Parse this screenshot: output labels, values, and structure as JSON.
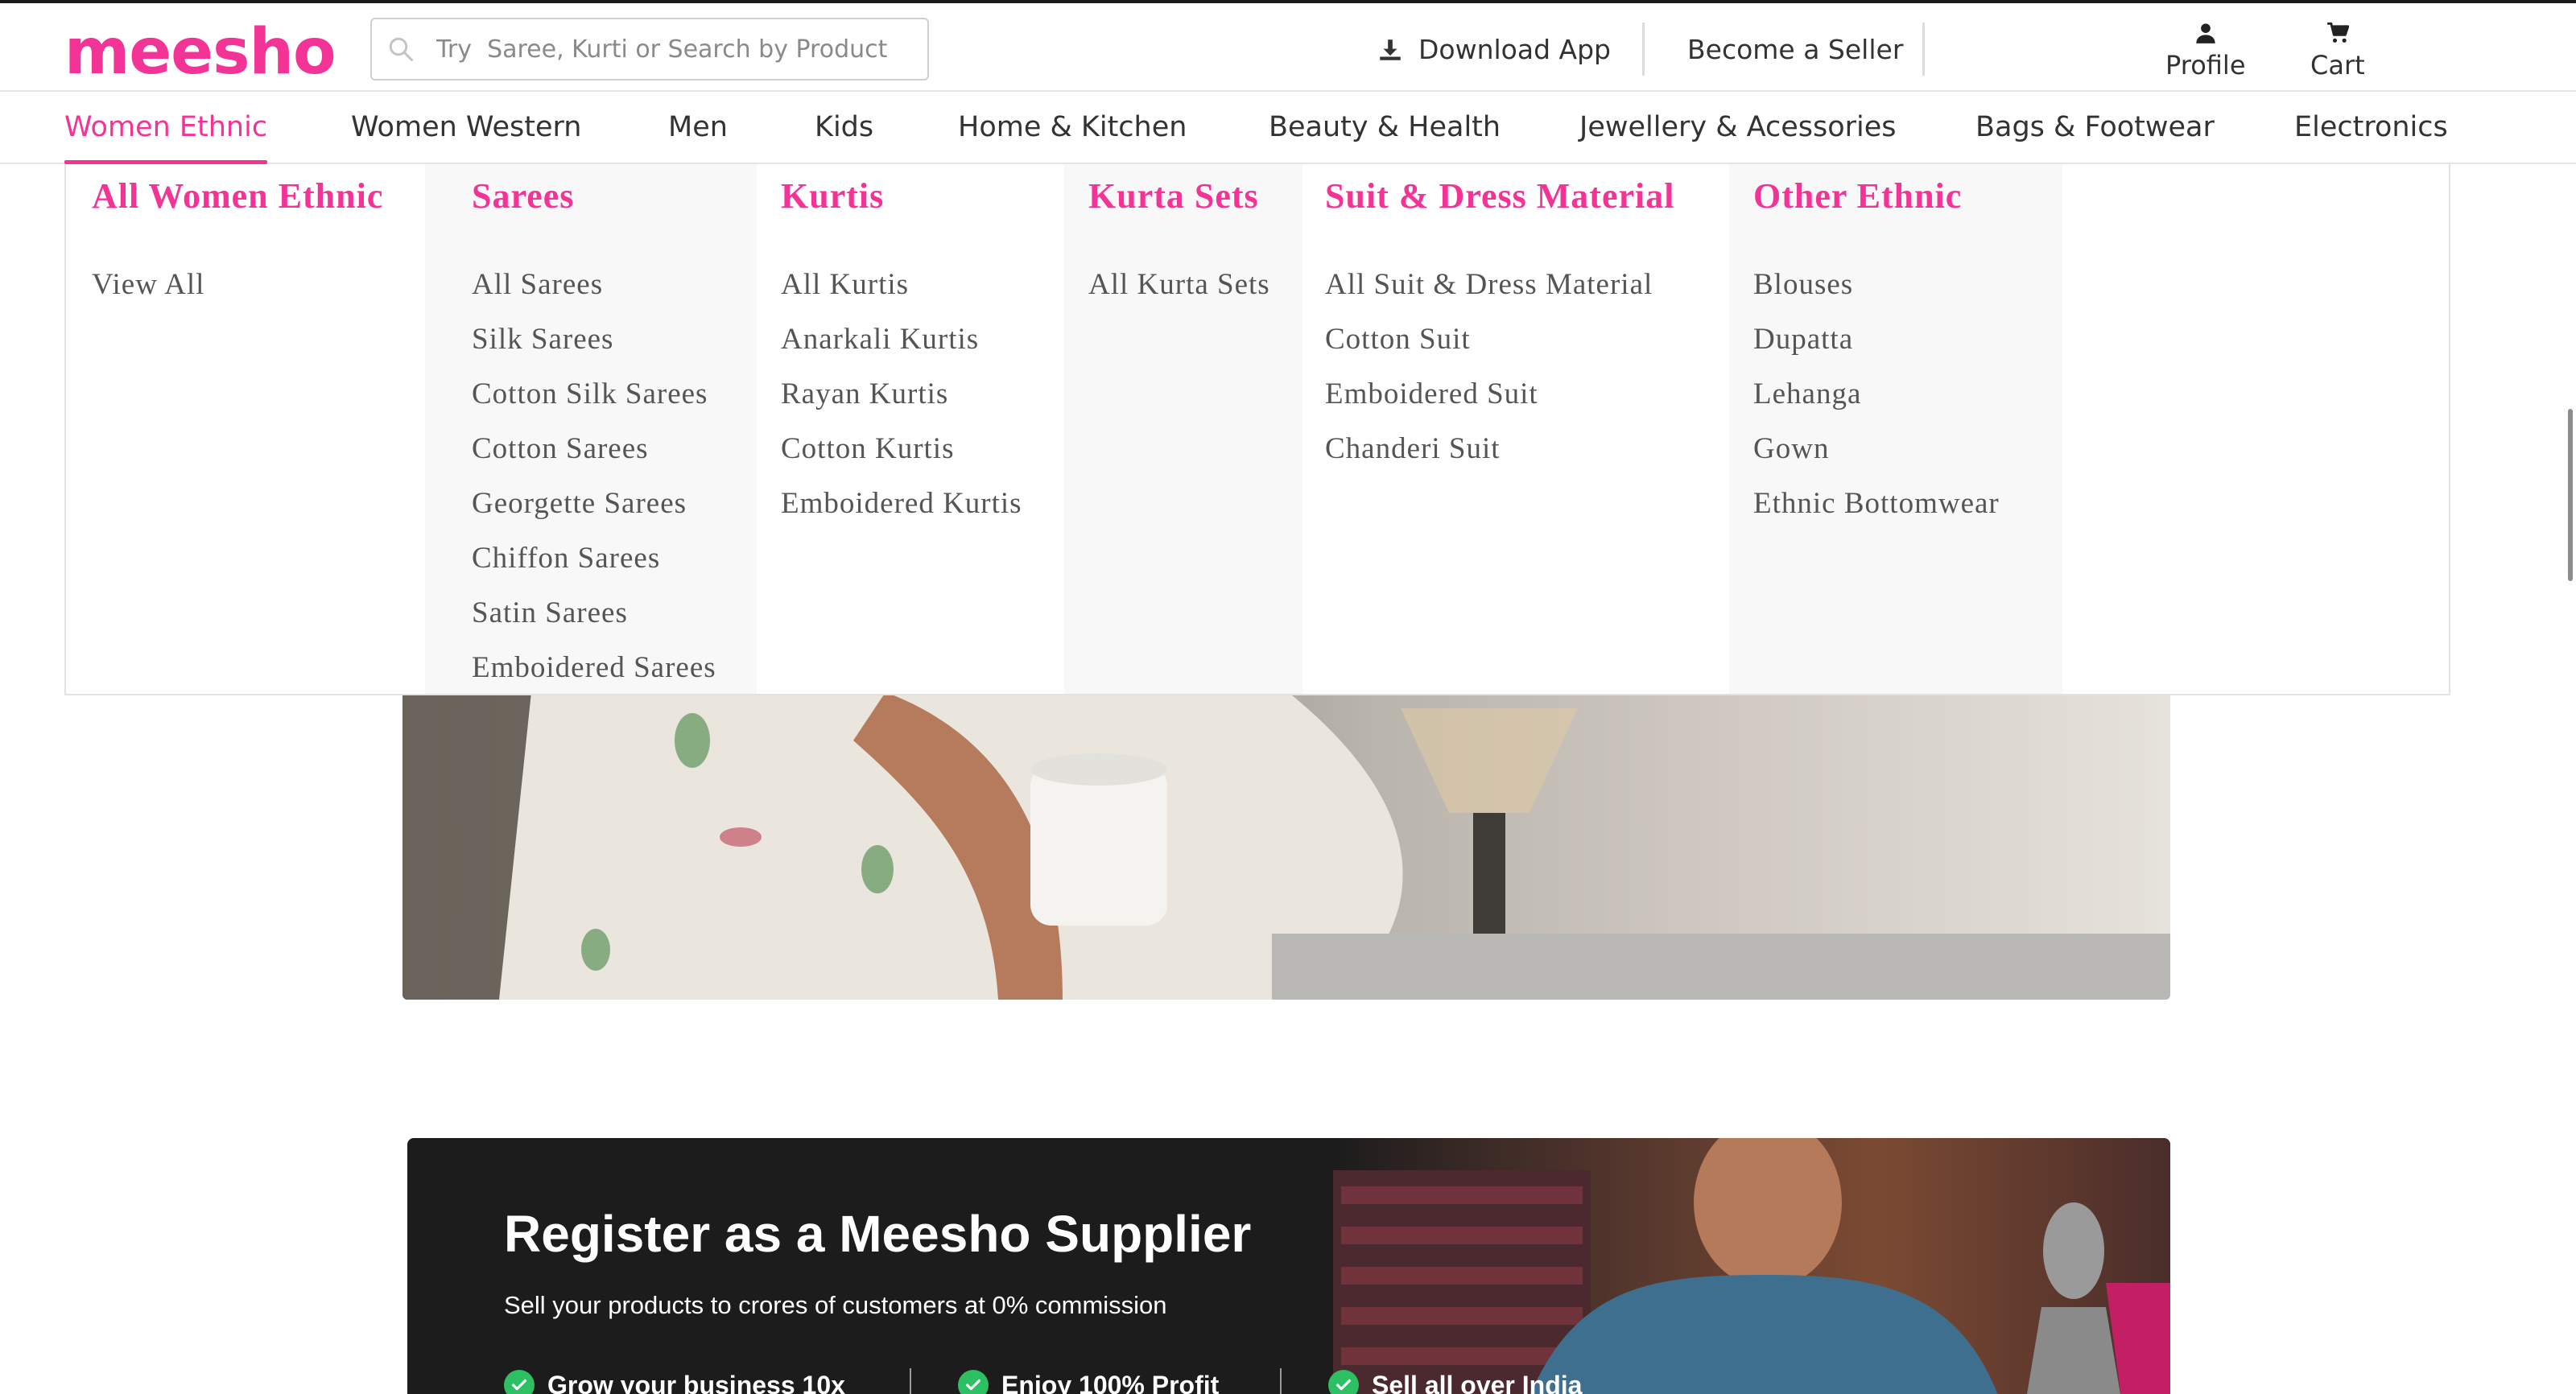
{
  "brand": {
    "logo_text": "meesho",
    "accent": "#f43397"
  },
  "search": {
    "placeholder": "Try  Saree, Kurti or Search by Product Code"
  },
  "header": {
    "download_app": "Download App",
    "become_seller": "Become a Seller",
    "profile": "Profile",
    "cart": "Cart"
  },
  "nav": {
    "categories": [
      "Women Ethnic",
      "Women Western",
      "Men",
      "Kids",
      "Home & Kitchen",
      "Beauty & Health",
      "Jewellery & Acessories",
      "Bags & Footwear",
      "Electronics"
    ],
    "active": "Women Ethnic"
  },
  "mega_menu": {
    "columns": [
      {
        "title": "All Women Ethnic",
        "items": [
          "View All"
        ]
      },
      {
        "title": "Sarees",
        "items": [
          "All Sarees",
          "Silk Sarees",
          "Cotton Silk Sarees",
          "Cotton Sarees",
          "Georgette Sarees",
          "Chiffon Sarees",
          "Satin Sarees",
          "Emboidered Sarees"
        ]
      },
      {
        "title": "Kurtis",
        "items": [
          "All Kurtis",
          "Anarkali Kurtis",
          "Rayan Kurtis",
          "Cotton Kurtis",
          "Emboidered Kurtis"
        ]
      },
      {
        "title": "Kurta Sets",
        "items": [
          "All Kurta Sets"
        ]
      },
      {
        "title": "Suit & Dress Material",
        "items": [
          "All Suit & Dress Material",
          "Cotton Suit",
          "Emboidered Suit",
          "Chanderi Suit"
        ]
      },
      {
        "title": "Other Ethnic",
        "items": [
          "Blouses",
          "Dupatta",
          "Lehanga",
          "Gown",
          "Ethnic Bottomwear"
        ]
      }
    ]
  },
  "supplier_banner": {
    "title": "Register as a Meesho Supplier",
    "subtitle": "Sell your products to crores of customers at 0% commission",
    "features": [
      "Grow your business 10x",
      "Enjoy 100% Profit",
      "Sell all over India"
    ]
  }
}
